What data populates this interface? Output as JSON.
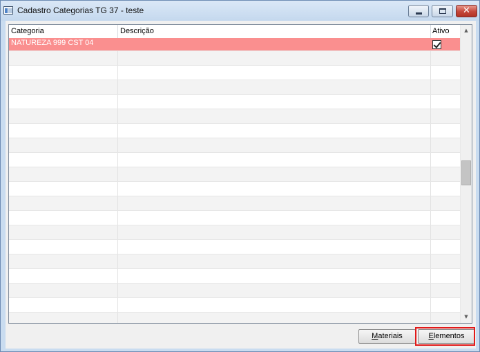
{
  "window": {
    "title": "Cadastro Categorias TG 37 - teste",
    "close_glyph": "✕"
  },
  "grid": {
    "columns": [
      "Categoria",
      "Descrição",
      "Ativo"
    ],
    "rows": [
      {
        "categoria": "NATUREZA 999 CST 04",
        "descricao": "",
        "ativo": true,
        "selected": true
      }
    ],
    "selected_row_color": "#fa8f8f"
  },
  "scrollbar": {
    "up_glyph": "▲",
    "down_glyph": "▼"
  },
  "buttons": {
    "materiais": {
      "mnemonic": "M",
      "rest": "ateriais"
    },
    "elementos": {
      "mnemonic": "E",
      "rest": "lementos"
    }
  }
}
